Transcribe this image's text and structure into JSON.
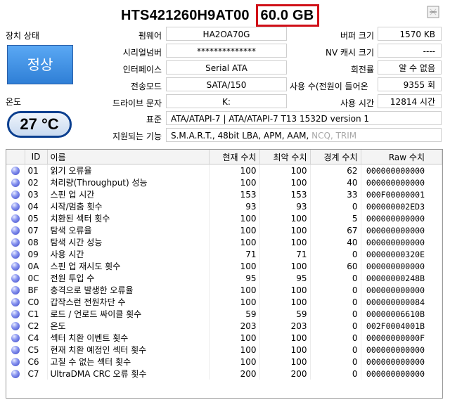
{
  "header": {
    "model": "HTS421260H9AT00",
    "capacity": "60.0 GB"
  },
  "status": {
    "label": "장치 상태",
    "value": "정상"
  },
  "temperature": {
    "label": "온도",
    "value": "27 °C"
  },
  "fields": {
    "firmware": {
      "label": "펌웨어",
      "value": "HA2OA70G"
    },
    "serial": {
      "label": "시리얼넘버",
      "value": "**************"
    },
    "interface": {
      "label": "인터페이스",
      "value": "Serial ATA"
    },
    "transfer_mode": {
      "label": "전송모드",
      "value": "SATA/150"
    },
    "drive_letter": {
      "label": "드라이브 문자",
      "value": "K:"
    },
    "buffer_size": {
      "label": "버퍼 크기",
      "value": "1570 KB"
    },
    "nv_cache": {
      "label": "NV 캐시 크기",
      "value": "----"
    },
    "rotation": {
      "label": "회전률",
      "value": "알 수 없음"
    },
    "power_on_count": {
      "label": "사용 수(전원이 들어온",
      "value": "9355 회"
    },
    "power_on_hours": {
      "label": "사용 시간",
      "value": "12814 시간"
    },
    "standard": {
      "label": "표준",
      "value": "ATA/ATAPI-7 | ATA/ATAPI-7 T13 1532D version 1"
    },
    "features": {
      "label": "지원되는 기능",
      "value": "S.M.A.R.T., 48bit LBA, APM, AAM, ",
      "disabled": "NCQ, TRIM"
    }
  },
  "table": {
    "headers": [
      "ID",
      "이름",
      "현재 수치",
      "최악 수치",
      "경계 수치",
      "Raw 수치"
    ],
    "rows": [
      [
        "01",
        "읽기 오류율",
        "100",
        "100",
        "62",
        "000000000000"
      ],
      [
        "02",
        "처리량(Throughput) 성능",
        "100",
        "100",
        "40",
        "000000000000"
      ],
      [
        "03",
        "스핀 업 시간",
        "153",
        "153",
        "33",
        "000F00000001"
      ],
      [
        "04",
        "시작/멈춤 횟수",
        "93",
        "93",
        "0",
        "000000002ED3"
      ],
      [
        "05",
        "치환된 섹터 횟수",
        "100",
        "100",
        "5",
        "000000000000"
      ],
      [
        "07",
        "탐색 오류율",
        "100",
        "100",
        "67",
        "000000000000"
      ],
      [
        "08",
        "탐색 시간 성능",
        "100",
        "100",
        "40",
        "000000000000"
      ],
      [
        "09",
        "사용 시간",
        "71",
        "71",
        "0",
        "00000000320E"
      ],
      [
        "0A",
        "스핀 업 재시도 횟수",
        "100",
        "100",
        "60",
        "000000000000"
      ],
      [
        "0C",
        "전원 투입 수",
        "95",
        "95",
        "0",
        "00000000248B"
      ],
      [
        "BF",
        "충격으로 발생한 오류율",
        "100",
        "100",
        "0",
        "000000000000"
      ],
      [
        "C0",
        "갑작스런 전원차단 수",
        "100",
        "100",
        "0",
        "000000000084"
      ],
      [
        "C1",
        "로드 / 언로드 싸이클 횟수",
        "59",
        "59",
        "0",
        "00000006610B"
      ],
      [
        "C2",
        "온도",
        "203",
        "203",
        "0",
        "002F0004001B"
      ],
      [
        "C4",
        "섹터 치환 이벤트 횟수",
        "100",
        "100",
        "0",
        "00000000000F"
      ],
      [
        "C5",
        "현재 치환 예정인 섹터 횟수",
        "100",
        "100",
        "0",
        "000000000000"
      ],
      [
        "C6",
        "고칠 수 없는 섹터 횟수",
        "100",
        "100",
        "0",
        "000000000000"
      ],
      [
        "C7",
        "UltraDMA CRC 오류 횟수",
        "200",
        "200",
        "0",
        "000000000000"
      ]
    ]
  }
}
